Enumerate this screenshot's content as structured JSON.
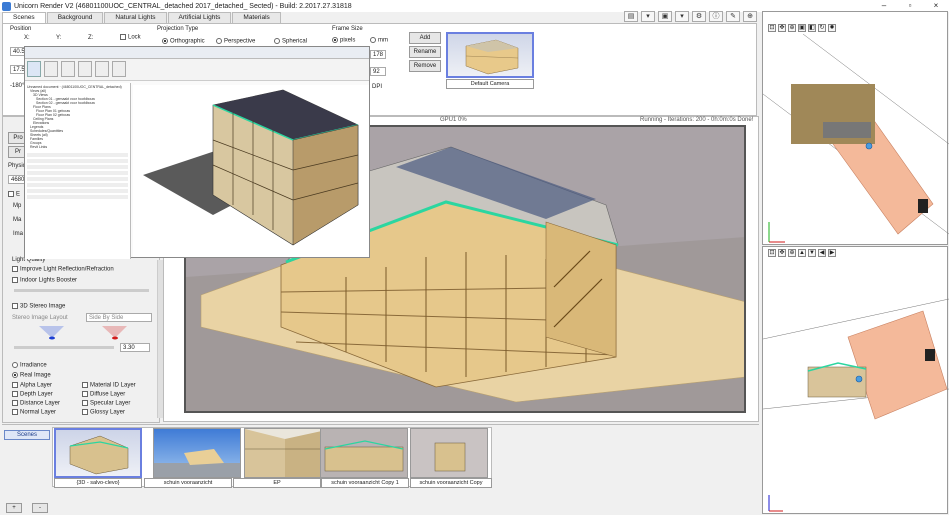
{
  "window": {
    "title": "Unicorn Render V2 (46801100UOC_CENTRAL_detached 2017_detached_ Sected) - Build: 2.2017.27.31818",
    "minimize": "–",
    "maximize": "▫",
    "close": "×"
  },
  "tabs": [
    "Scenes",
    "Background",
    "Natural Lights",
    "Artificial Lights",
    "Materials"
  ],
  "position": {
    "label": "Position",
    "x_label": "X:",
    "y_label": "Y:",
    "z_label": "Z:",
    "lock_label": "Lock",
    "x_value": "40.5",
    "row2_value": "17.5",
    "row3_value": "-180°"
  },
  "projection": {
    "label": "Projection Type",
    "options": [
      "Orthographic",
      "Perspective",
      "Spherical"
    ],
    "selected": "Orthographic"
  },
  "frame_size": {
    "label": "Frame Size",
    "options": [
      "pixels",
      "mm"
    ],
    "selected": "pixels",
    "width": "178",
    "height": "92",
    "dpi_label": "DPI"
  },
  "camera_buttons": {
    "add": "Add",
    "rename": "Rename",
    "remove": "Remove"
  },
  "camera_list": {
    "item": "Default Camera"
  },
  "left_panel": {
    "pro_label": "Pro",
    "pr_label": "Pr",
    "physic_label": "Physic",
    "val_46801": "46801",
    "e_label": "E",
    "mp_label": "Mp",
    "ma_label": "Ma",
    "ima_label": "Ima",
    "light_quality": "Light Quality",
    "improve_light": "Improve Light Reflection/Refraction",
    "indoor_booster": "Indoor Lights Booster",
    "stereo_image": "3D Stereo Image",
    "stereo_layout_label": "Stereo Image Layout",
    "stereo_layout_value": "Side By Side",
    "stereo_value": "3.30",
    "irradiance": "Irradiance",
    "real_image": "Real Image",
    "layers_col1": [
      "Alpha Layer",
      "Depth Layer",
      "Distance Layer",
      "Normal Layer"
    ],
    "layers_col2": [
      "Material ID Layer",
      "Diffuse Layer",
      "Specular Layer",
      "Glossy Layer"
    ]
  },
  "viewport": {
    "gpu_label": "GPU1 0%",
    "status": "Running - Iterations: 200 - 0h:0m:0s Done!"
  },
  "scenes_bar": {
    "label": "Scenes",
    "add": "+",
    "remove": "-",
    "thumbnails": [
      {
        "caption": "{3D - salvo-clevo}"
      },
      {
        "caption": "schuin vooraanzicht"
      },
      {
        "caption": "EP"
      },
      {
        "caption": "schuin vooraanzicht Copy 1"
      },
      {
        "caption": "schuin vooraanzicht Copy"
      }
    ]
  },
  "revit_overlay": {
    "tree": [
      "Unnamed document · (46801100UOC_CENTRAL_detached)",
      "Views (all)",
      "3D Views",
      "Section 01 - gemaakt voor hoofdbouw",
      "Section 02 - gemaakt voor hoofdbouw",
      "Floor Plans",
      "Floor Plan 01 gebouw",
      "Floor Plan 02 gebouw",
      "Ceiling Plans",
      "Elevations",
      "Legends",
      "Schedules/Quantities",
      "Sheets (all)",
      "Families",
      "Groups",
      "Revit Links"
    ]
  },
  "colors": {
    "accent_blue": "#3a6fd0",
    "building_wood": "#e9cf97",
    "roof_green": "#2bd6a0",
    "floor_salmon": "#f4b99a",
    "sky_grey": "#a9a2a6"
  }
}
